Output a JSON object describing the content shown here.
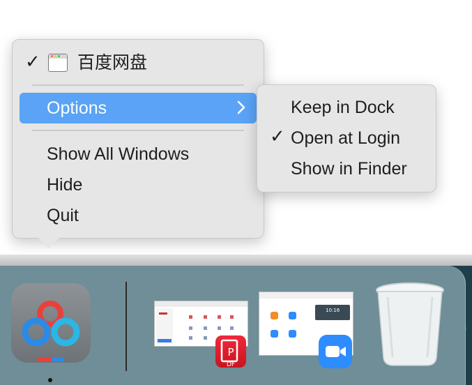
{
  "context_menu": {
    "app_name": "百度网盘",
    "app_checked": true,
    "items": [
      {
        "label": "Options",
        "highlighted": true,
        "has_submenu": true
      },
      {
        "label": "Show All Windows"
      },
      {
        "label": "Hide"
      },
      {
        "label": "Quit"
      }
    ]
  },
  "submenu": {
    "items": [
      {
        "label": "Keep in Dock",
        "checked": false
      },
      {
        "label": "Open at Login",
        "checked": true
      },
      {
        "label": "Show in Finder",
        "checked": false
      }
    ]
  },
  "dock": {
    "apps": [
      {
        "icon": "baidu-netdisk-icon",
        "running": true
      },
      {
        "icon": "pdf-app-window-thumbnail"
      },
      {
        "icon": "zoom-window-thumbnail"
      },
      {
        "icon": "trash-icon"
      }
    ],
    "thumbnails": {
      "zoom_time": "10:16"
    }
  },
  "colors": {
    "highlight": "#5aa3f6",
    "menu_bg": "#e6e6e6",
    "dock_bg": "#6f8e97"
  }
}
